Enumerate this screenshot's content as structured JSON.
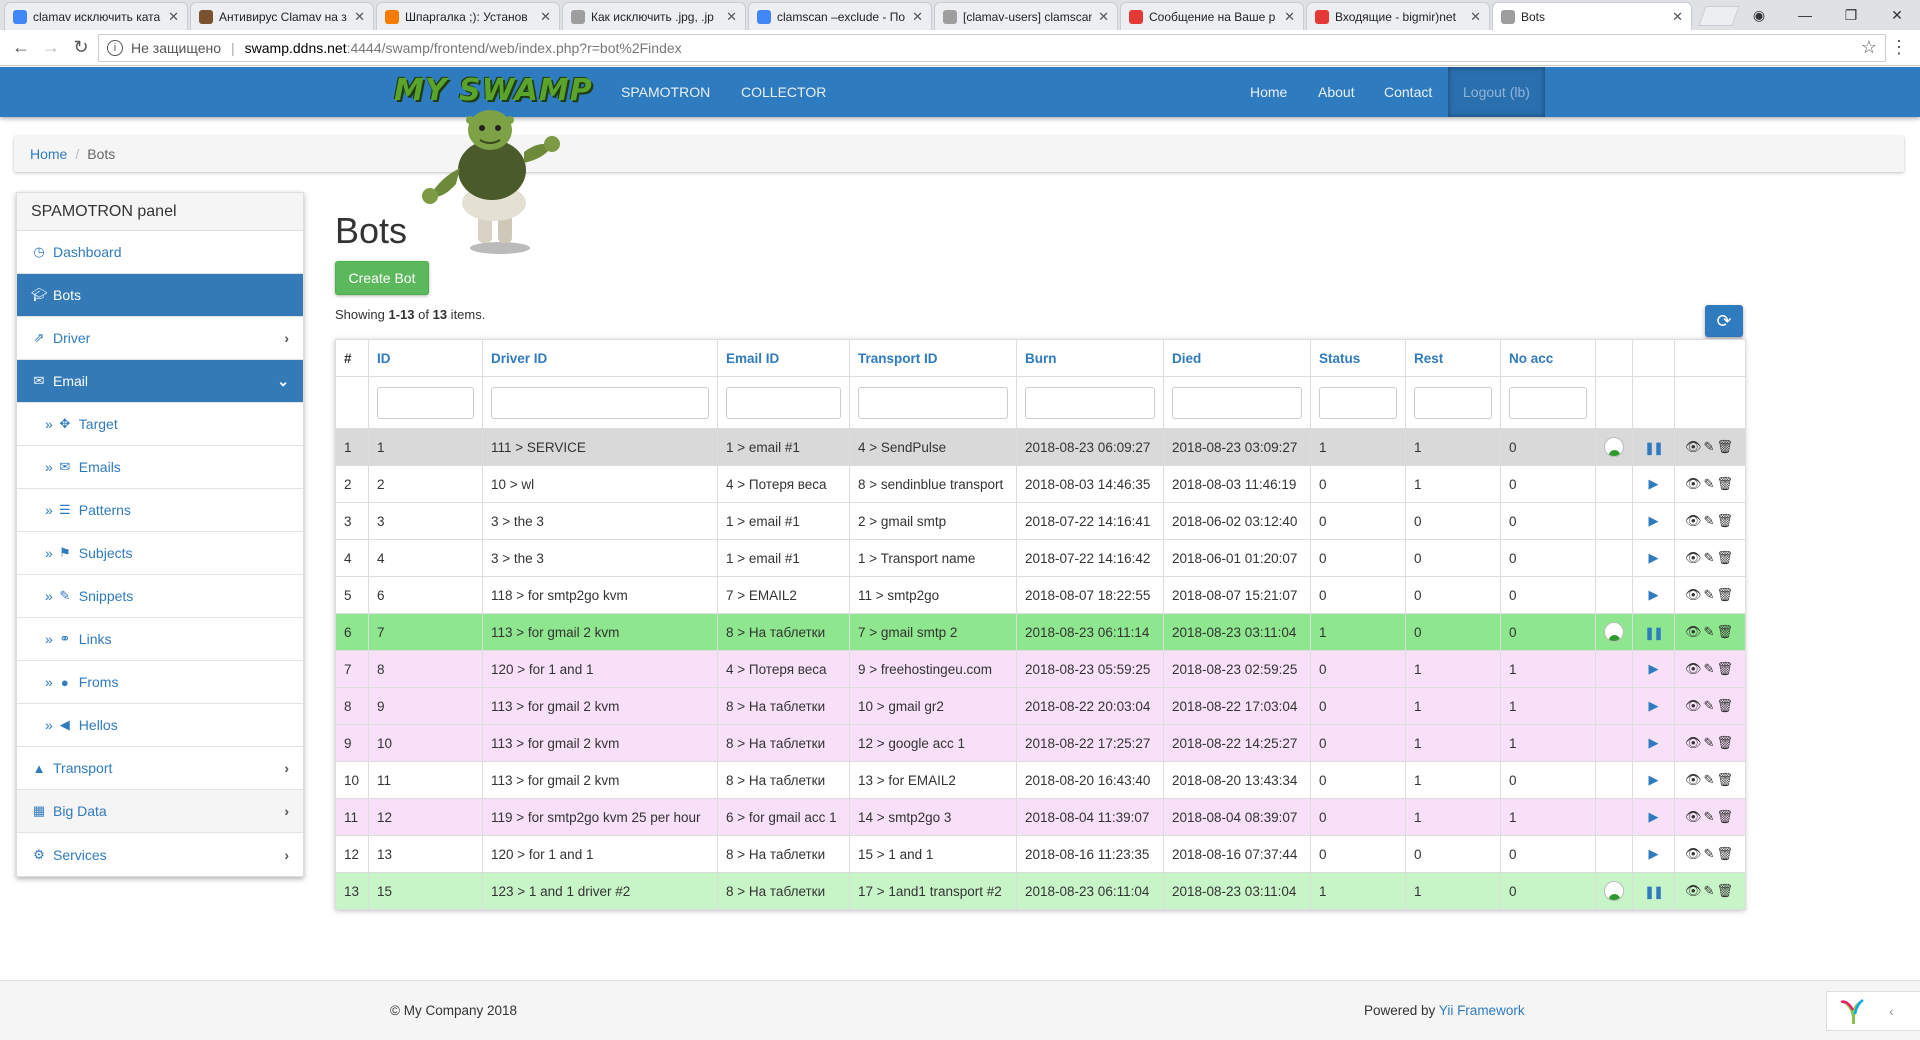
{
  "browser": {
    "tabs": [
      {
        "label": "clamav исключить ката",
        "color": "#4285f4"
      },
      {
        "label": "Антивирус Clamav на з",
        "color": "#7a5230"
      },
      {
        "label": "Шпаргалка ;): Установ",
        "color": "#f57c00"
      },
      {
        "label": "Как исключить .jpg, .jp",
        "color": "#9e9e9e"
      },
      {
        "label": "clamscan –exclude - По",
        "color": "#4285f4"
      },
      {
        "label": "[clamav-users] clamscan",
        "color": "#9e9e9e"
      },
      {
        "label": "Сообщение на Ваше р",
        "color": "#e53935"
      },
      {
        "label": "Входящие - bigmir)net",
        "color": "#e53935"
      },
      {
        "label": "Bots",
        "color": "#9e9e9e"
      }
    ],
    "security_label": "Не защищено",
    "url_host": "swamp.ddns.net",
    "url_path": ":4444/swamp/frontend/web/index.php?r=bot%2Findex"
  },
  "navbar": {
    "brand": "MY SWAMP",
    "left_links": [
      "SPAMOTRON",
      "COLLECTOR"
    ],
    "right_links": [
      "Home",
      "About",
      "Contact"
    ],
    "logout": "Logout (lb)"
  },
  "breadcrumb": {
    "home": "Home",
    "current": "Bots"
  },
  "sidebar": {
    "title": "SPAMOTRON panel",
    "items": [
      {
        "label": "Dashboard",
        "icon": "dashboard-icon"
      },
      {
        "label": "Bots",
        "icon": "graduation-cap-icon"
      },
      {
        "label": "Driver",
        "icon": "share-icon"
      },
      {
        "label": "Email",
        "icon": "envelope-icon"
      },
      {
        "label": "Target",
        "icon": "target-icon"
      },
      {
        "label": "Emails",
        "icon": "envelope-icon"
      },
      {
        "label": "Patterns",
        "icon": "list-icon"
      },
      {
        "label": "Subjects",
        "icon": "flag-icon"
      },
      {
        "label": "Snippets",
        "icon": "pushpin-icon"
      },
      {
        "label": "Links",
        "icon": "link-icon"
      },
      {
        "label": "Froms",
        "icon": "user-icon"
      },
      {
        "label": "Hellos",
        "icon": "bullhorn-icon"
      },
      {
        "label": "Transport",
        "icon": "road-icon"
      },
      {
        "label": "Big Data",
        "icon": "grid-icon"
      },
      {
        "label": "Services",
        "icon": "cog-icon"
      }
    ]
  },
  "main": {
    "title": "Bots",
    "create_button": "Create Bot",
    "summary_prefix": "Showing ",
    "summary_range": "1-13",
    "summary_of": " of ",
    "summary_total": "13",
    "summary_suffix": " items."
  },
  "grid": {
    "columns": [
      "#",
      "ID",
      "Driver ID",
      "Email ID",
      "Transport ID",
      "Burn",
      "Died",
      "Status",
      "Rest",
      "No acc"
    ],
    "rows": [
      {
        "n": "1",
        "id": "1",
        "driver": "111 > SERVICE",
        "email": "1 > email #1",
        "transport": "4 > SendPulse",
        "burn": "2018-08-23 06:09:27",
        "died": "2018-08-23 03:09:27",
        "status": "1",
        "rest": "1",
        "noacc": "0",
        "avatar": true,
        "action": "pause",
        "color": "grey"
      },
      {
        "n": "2",
        "id": "2",
        "driver": "10 > wl",
        "email": "4 > Потеря веса",
        "transport": "8 > sendinblue transport",
        "burn": "2018-08-03 14:46:35",
        "died": "2018-08-03 11:46:19",
        "status": "0",
        "rest": "1",
        "noacc": "0",
        "avatar": false,
        "action": "play",
        "color": "white"
      },
      {
        "n": "3",
        "id": "3",
        "driver": "3 > the 3",
        "email": "1 > email #1",
        "transport": "2 > gmail smtp",
        "burn": "2018-07-22 14:16:41",
        "died": "2018-06-02 03:12:40",
        "status": "0",
        "rest": "0",
        "noacc": "0",
        "avatar": false,
        "action": "play",
        "color": "white"
      },
      {
        "n": "4",
        "id": "4",
        "driver": "3 > the 3",
        "email": "1 > email #1",
        "transport": "1 > Transport name",
        "burn": "2018-07-22 14:16:42",
        "died": "2018-06-01 01:20:07",
        "status": "0",
        "rest": "0",
        "noacc": "0",
        "avatar": false,
        "action": "play",
        "color": "white"
      },
      {
        "n": "5",
        "id": "6",
        "driver": "118 > for smtp2go kvm",
        "email": "7 > EMAIL2",
        "transport": "11 > smtp2go",
        "burn": "2018-08-07 18:22:55",
        "died": "2018-08-07 15:21:07",
        "status": "0",
        "rest": "0",
        "noacc": "0",
        "avatar": false,
        "action": "play",
        "color": "white"
      },
      {
        "n": "6",
        "id": "7",
        "driver": "113 > for gmail 2 kvm",
        "email": "8 > На таблетки",
        "transport": "7 > gmail smtp 2",
        "burn": "2018-08-23 06:11:14",
        "died": "2018-08-23 03:11:04",
        "status": "1",
        "rest": "0",
        "noacc": "0",
        "avatar": true,
        "action": "pause",
        "color": "green"
      },
      {
        "n": "7",
        "id": "8",
        "driver": "120 > for 1 and 1",
        "email": "4 > Потеря веса",
        "transport": "9 > freehostingeu.com",
        "burn": "2018-08-23 05:59:25",
        "died": "2018-08-23 02:59:25",
        "status": "0",
        "rest": "1",
        "noacc": "1",
        "avatar": false,
        "action": "play",
        "color": "pink"
      },
      {
        "n": "8",
        "id": "9",
        "driver": "113 > for gmail 2 kvm",
        "email": "8 > На таблетки",
        "transport": "10 > gmail gr2",
        "burn": "2018-08-22 20:03:04",
        "died": "2018-08-22 17:03:04",
        "status": "0",
        "rest": "1",
        "noacc": "1",
        "avatar": false,
        "action": "play",
        "color": "pink"
      },
      {
        "n": "9",
        "id": "10",
        "driver": "113 > for gmail 2 kvm",
        "email": "8 > На таблетки",
        "transport": "12 > google acc 1",
        "burn": "2018-08-22 17:25:27",
        "died": "2018-08-22 14:25:27",
        "status": "0",
        "rest": "1",
        "noacc": "1",
        "avatar": false,
        "action": "play",
        "color": "pink"
      },
      {
        "n": "10",
        "id": "11",
        "driver": "113 > for gmail 2 kvm",
        "email": "8 > На таблетки",
        "transport": "13 > for EMAIL2",
        "burn": "2018-08-20 16:43:40",
        "died": "2018-08-20 13:43:34",
        "status": "0",
        "rest": "1",
        "noacc": "0",
        "avatar": false,
        "action": "play",
        "color": "white"
      },
      {
        "n": "11",
        "id": "12",
        "driver": "119 > for smtp2go kvm 25 per hour",
        "email": "6 > for gmail acc 1",
        "transport": "14 > smtp2go 3",
        "burn": "2018-08-04 11:39:07",
        "died": "2018-08-04 08:39:07",
        "status": "0",
        "rest": "1",
        "noacc": "1",
        "avatar": false,
        "action": "play",
        "color": "pink"
      },
      {
        "n": "12",
        "id": "13",
        "driver": "120 > for 1 and 1",
        "email": "8 > На таблетки",
        "transport": "15 > 1 and 1",
        "burn": "2018-08-16 11:23:35",
        "died": "2018-08-16 07:37:44",
        "status": "0",
        "rest": "0",
        "noacc": "0",
        "avatar": false,
        "action": "play",
        "color": "white"
      },
      {
        "n": "13",
        "id": "15",
        "driver": "123 > 1 and 1 driver #2",
        "email": "8 > На таблетки",
        "transport": "17 > 1and1 transport #2",
        "burn": "2018-08-23 06:11:04",
        "died": "2018-08-23 03:11:04",
        "status": "1",
        "rest": "1",
        "noacc": "0",
        "avatar": true,
        "action": "pause",
        "color": "lgreen"
      }
    ]
  },
  "footer": {
    "copyright": "© My Company 2018",
    "powered_prefix": "Powered by ",
    "powered_link": "Yii Framework"
  },
  "colors": {
    "navbar": "#2f7bbf",
    "accent": "#337ab7",
    "create_button": "#5cb85c",
    "row_grey": "#d9d9d9",
    "row_green": "#8ee68e",
    "row_pink": "#f8e0f8",
    "row_light_green": "#c8f5c8"
  }
}
